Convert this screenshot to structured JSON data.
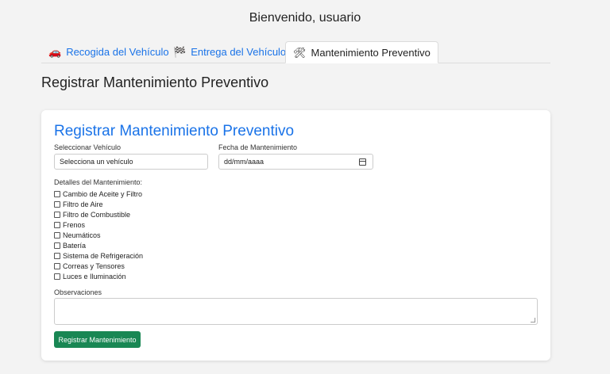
{
  "header": {
    "welcome": "Bienvenido, usuario"
  },
  "tabs": [
    {
      "icon": "car-icon",
      "glyph": "🚗",
      "label": "Recogida del Vehículo",
      "active": false
    },
    {
      "icon": "flag-icon",
      "glyph": "🏁",
      "label": "Entrega del Vehículo",
      "active": false
    },
    {
      "icon": "tools-icon",
      "glyph": "🛠",
      "label": "Mantenimiento Preventivo",
      "active": true
    }
  ],
  "page": {
    "title": "Registrar Mantenimiento Preventivo"
  },
  "form": {
    "title": "Registrar Mantenimiento Preventivo",
    "vehicle_label": "Seleccionar Vehículo",
    "vehicle_value": "Selecciona un vehículo",
    "date_label": "Fecha de Mantenimiento",
    "date_value": "dd/mm/aaaa",
    "details_label": "Detalles del Mantenimiento:",
    "details": [
      "Cambio de Aceite y Filtro",
      "Filtro de Aire",
      "Filtro de Combustible",
      "Frenos",
      "Neumáticos",
      "Batería",
      "Sistema de Refrigeración",
      "Correas y Tensores",
      "Luces e Iluminación"
    ],
    "notes_label": "Observaciones",
    "notes_value": "",
    "submit_label": "Registrar Mantenimiento"
  },
  "colors": {
    "accent": "#1a73e8",
    "submit": "#198754",
    "background": "#f3f3f3"
  }
}
